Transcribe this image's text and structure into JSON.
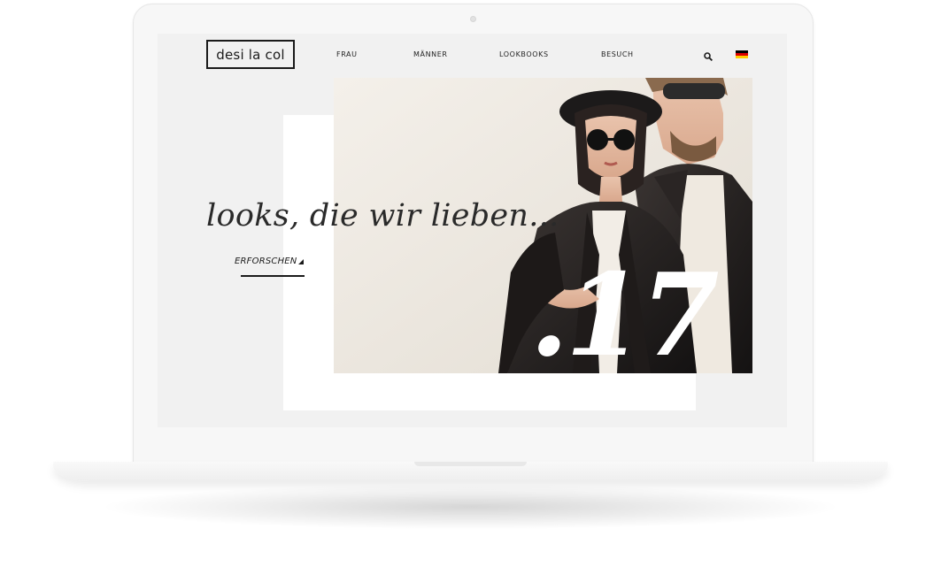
{
  "brand": {
    "logo_text": "desi la col"
  },
  "nav": {
    "items": [
      {
        "label": "FRAU"
      },
      {
        "label": "MÄNNER"
      },
      {
        "label": "LOOKBOOKS"
      },
      {
        "label": "BESUCH"
      }
    ],
    "search_icon": "search-icon",
    "language_icon": "german-flag-icon"
  },
  "hero": {
    "tagline": "looks, die wir lieben...",
    "cta_label": "ERFORSCHEN",
    "year_label": ".17",
    "image": "fashion-photo-couple-leather-jackets-sunglasses"
  },
  "colors": {
    "screen_bg": "#f1f1f1",
    "text": "#1a1a1a",
    "flag_black": "#000000",
    "flag_red": "#dd0000",
    "flag_gold": "#ffce00"
  }
}
